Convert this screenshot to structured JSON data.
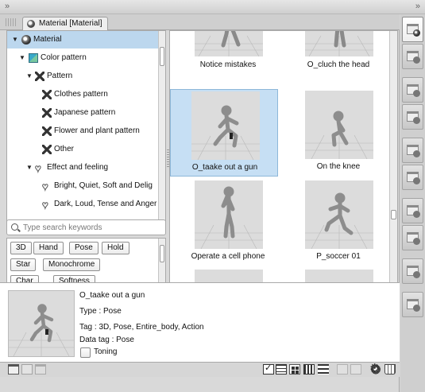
{
  "window": {
    "collapse_left_glyph": "»",
    "collapse_right_glyph": "»"
  },
  "tab": {
    "title": "Material [Material]",
    "icon": "material-sphere-icon"
  },
  "tree": {
    "items": [
      {
        "label": "Material",
        "icon": "material-sphere-icon",
        "expanded": true,
        "selected": true
      },
      {
        "label": "Color pattern",
        "icon": "color-pattern-icon",
        "expanded": true,
        "selected": false
      },
      {
        "label": "Pattern",
        "icon": "pattern-icon",
        "expanded": true,
        "selected": false
      },
      {
        "label": "Clothes pattern",
        "icon": "pattern-icon",
        "expanded": false,
        "selected": false
      },
      {
        "label": "Japanese pattern",
        "icon": "pattern-icon",
        "expanded": false,
        "selected": false
      },
      {
        "label": "Flower and plant pattern",
        "icon": "pattern-icon",
        "expanded": false,
        "selected": false
      },
      {
        "label": "Other",
        "icon": "pattern-icon",
        "expanded": false,
        "selected": false
      },
      {
        "label": "Effect and feeling",
        "icon": "heart-icon",
        "expanded": true,
        "selected": false
      },
      {
        "label": "Bright, Quiet, Soft and Delig",
        "icon": "heart-icon",
        "expanded": false,
        "selected": false
      },
      {
        "label": "Dark, Loud, Tense and Anger",
        "icon": "heart-icon",
        "expanded": false,
        "selected": false
      }
    ]
  },
  "search": {
    "placeholder": "Type search keywords",
    "value": ""
  },
  "tags": [
    "3D",
    "Hand",
    "Pose",
    "Hold",
    "Star",
    "Monochrome",
    "Char",
    "Softness"
  ],
  "grid": {
    "items": [
      {
        "label": "Notice mistakes",
        "selected": false
      },
      {
        "label": "O_cluch the head",
        "selected": false
      },
      {
        "label": "O_taake out a gun",
        "selected": true
      },
      {
        "label": "On the knee",
        "selected": false
      },
      {
        "label": "Operate a cell phone",
        "selected": false
      },
      {
        "label": "P_soccer 01",
        "selected": false
      },
      {
        "label": "",
        "selected": false
      },
      {
        "label": "",
        "selected": false
      }
    ]
  },
  "detail": {
    "name": "O_taake out a gun",
    "type_line": "Type : Pose",
    "tag_line": "Tag : 3D, Pose, Entire_body, Action",
    "datatag_line": "Data tag : Pose",
    "toning_label": "Toning",
    "toning_checked": false
  },
  "toolbar": {
    "left_icons": [
      "new-folder-icon",
      "edit-folder-icon",
      "copy-folder-icon"
    ],
    "right_icons": [
      "check-icon",
      "list-view-icon",
      "large-grid-view-icon",
      "small-grid-view-icon",
      "detail-view-icon",
      "paste-icon",
      "paste-into-icon",
      "settings-gear-icon",
      "trash-icon"
    ]
  },
  "sidebar": {
    "buttons": [
      {
        "name": "material-palette-button",
        "active": true
      },
      {
        "name": "material-add-button",
        "active": false
      },
      {
        "name": "material-remove-button",
        "active": false
      },
      {
        "name": "material-pattern-button",
        "active": false
      },
      {
        "name": "material-layout-button",
        "active": false
      },
      {
        "name": "material-effect-button",
        "active": false
      },
      {
        "name": "material-image-button",
        "active": false
      },
      {
        "name": "material-edit-button",
        "active": false
      },
      {
        "name": "material-3d-button",
        "active": false
      },
      {
        "name": "material-figure-button",
        "active": false
      }
    ]
  },
  "colors": {
    "selection": "#bcd7ee",
    "panel_bg": "#d9d9d9",
    "thumb_bg": "#dcdcdc"
  }
}
